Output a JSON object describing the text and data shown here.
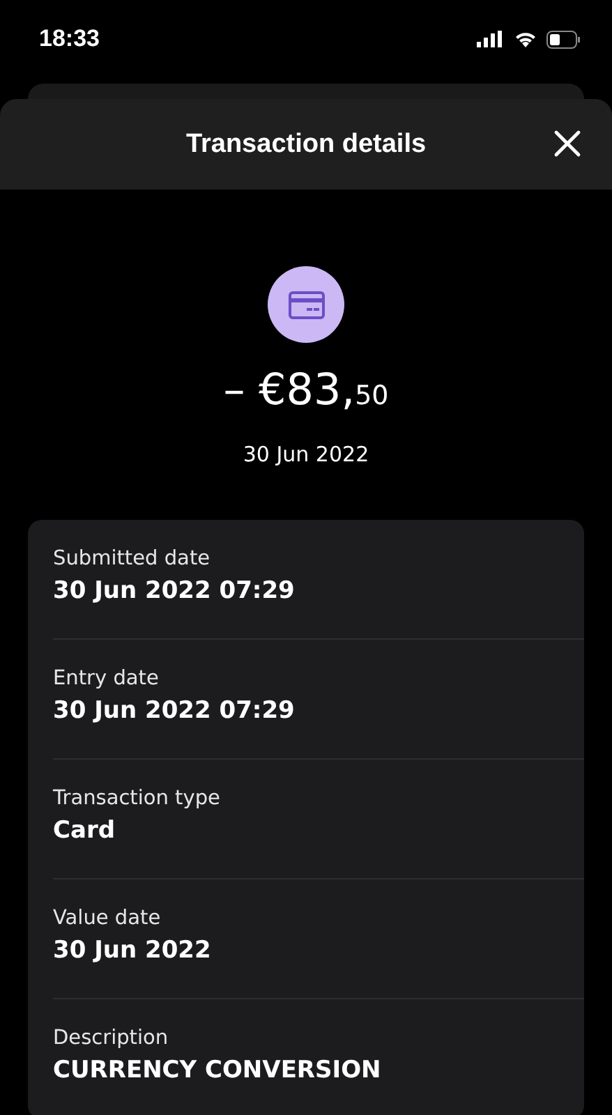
{
  "status_bar": {
    "time": "18:33"
  },
  "sheet": {
    "title": "Transaction details"
  },
  "transaction": {
    "amount": "– €83,",
    "amount_minor": "50",
    "date": "30 Jun 2022"
  },
  "details": [
    {
      "label": "Submitted date",
      "value": "30 Jun 2022 07:29"
    },
    {
      "label": "Entry date",
      "value": "30 Jun 2022 07:29"
    },
    {
      "label": "Transaction type",
      "value": "Card"
    },
    {
      "label": "Value date",
      "value": "30 Jun 2022"
    },
    {
      "label": "Description",
      "value": "CURRENCY CONVERSION"
    }
  ]
}
